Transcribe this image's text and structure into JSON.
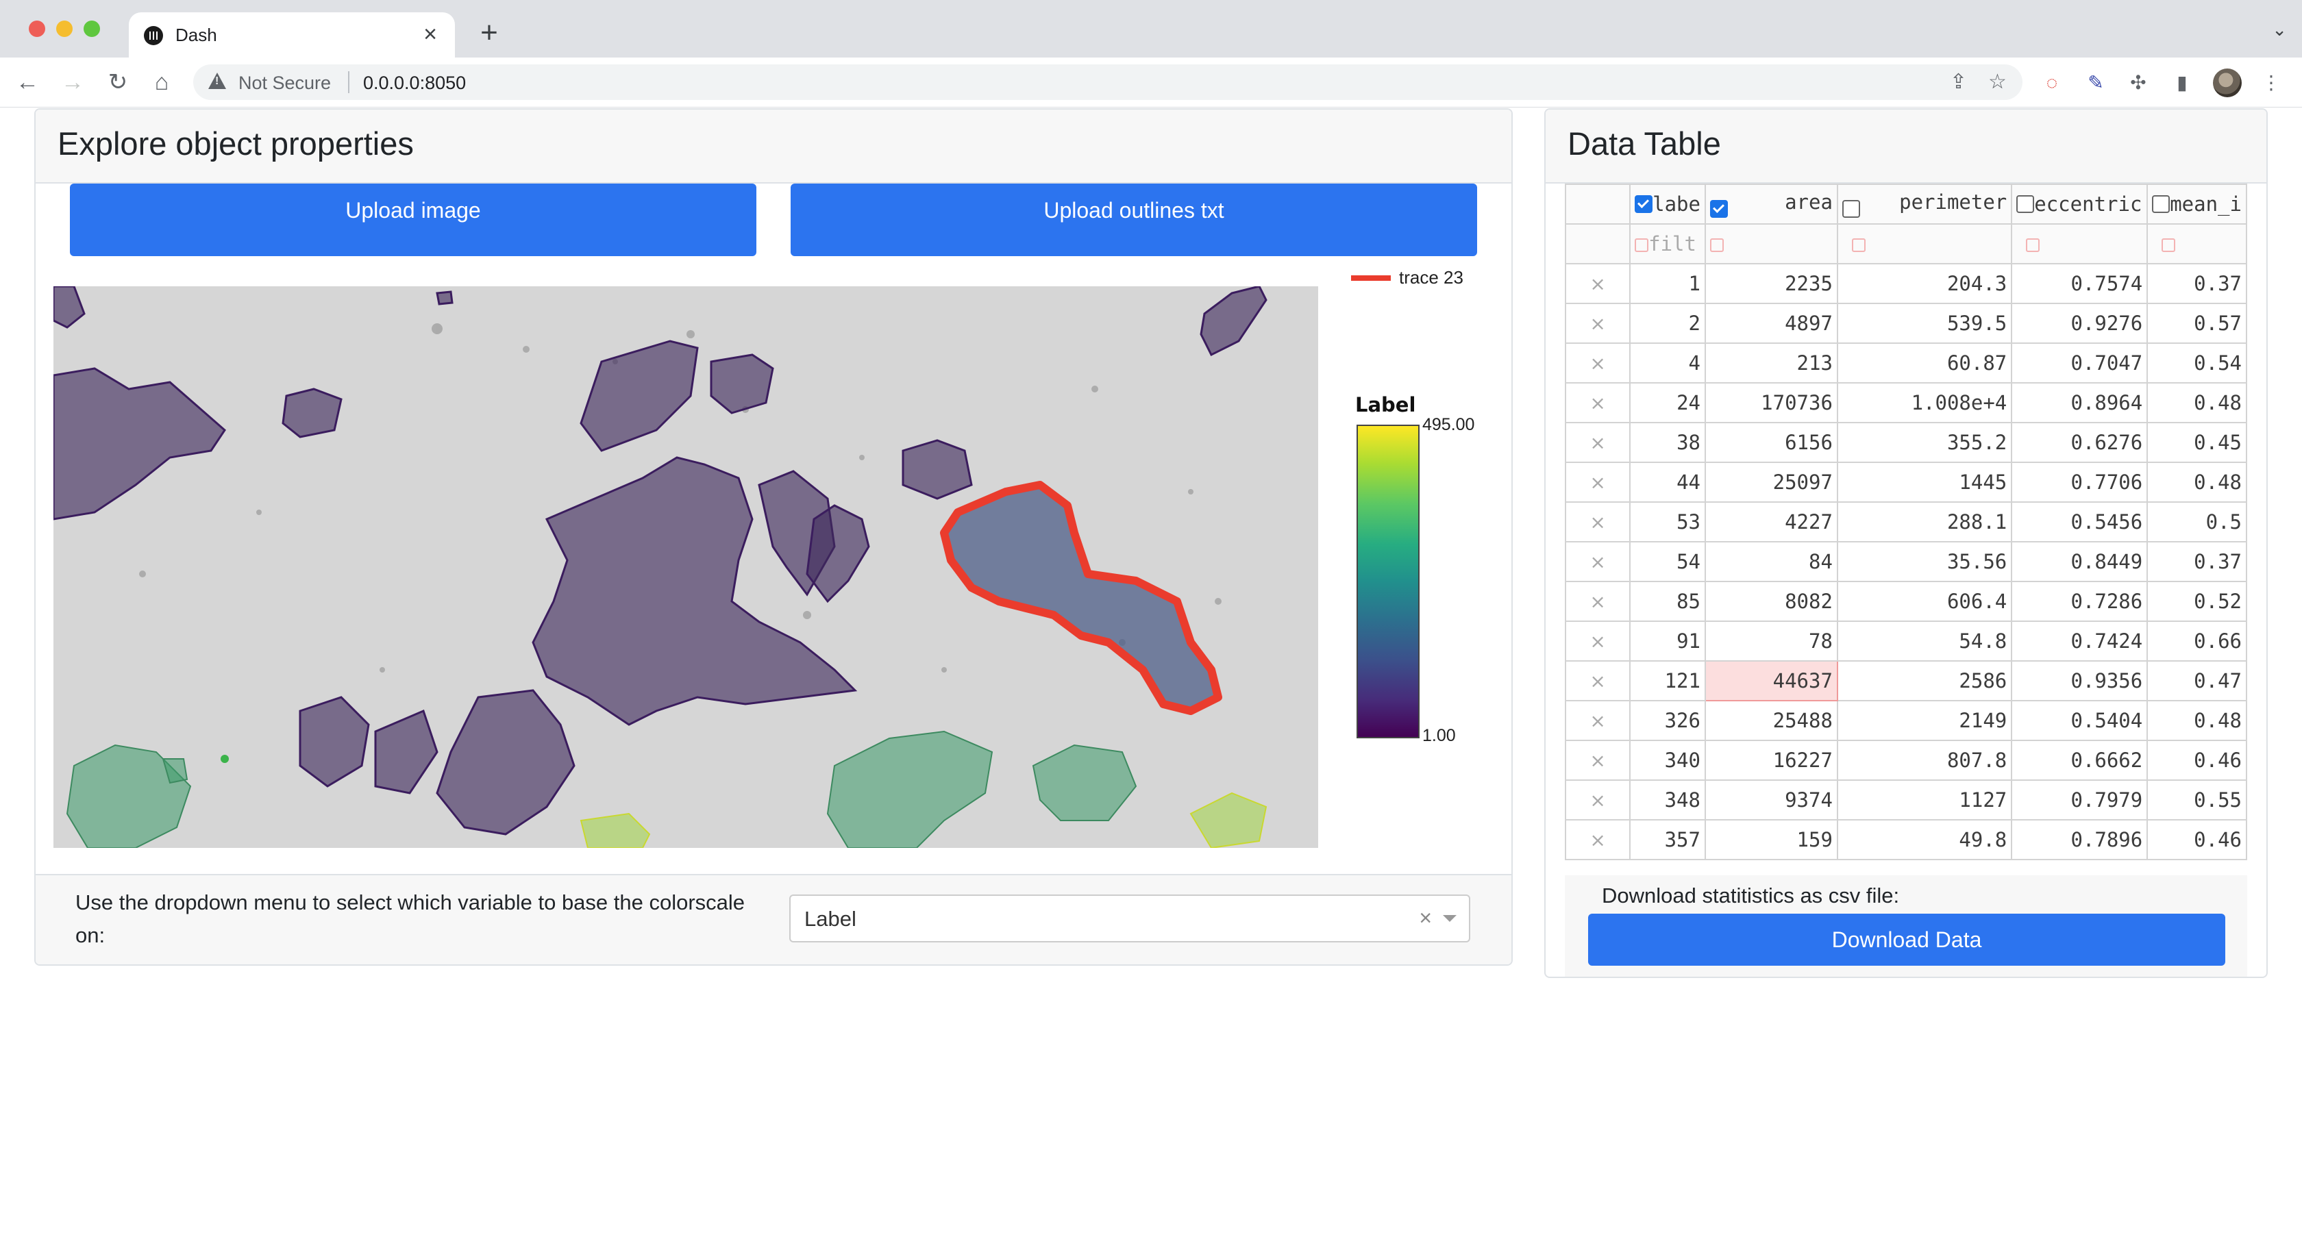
{
  "browser": {
    "tab_title": "Dash",
    "security_label": "Not Secure",
    "url": "0.0.0.0:8050"
  },
  "left_card": {
    "title": "Explore object properties",
    "upload_image_label": "Upload image",
    "upload_outlines_label": "Upload outlines txt",
    "legend_trace": "trace 23",
    "colorbar": {
      "title": "Label",
      "max": "495.00",
      "min": "1.00"
    },
    "footer_text": "Use the dropdown menu to select which variable to base the colorscale on:",
    "dropdown_value": "Label"
  },
  "colors": {
    "accent": "#2c74ef",
    "highlight_trace": "#ea3c2d"
  },
  "right_card": {
    "title": "Data Table",
    "columns": [
      "labe",
      "area",
      "perimeter",
      "eccentric",
      "mean_i"
    ],
    "filter_placeholder": "filt",
    "rows": [
      [
        "1",
        "2235",
        "204.3",
        "0.7574",
        "0.37"
      ],
      [
        "2",
        "4897",
        "539.5",
        "0.9276",
        "0.57"
      ],
      [
        "4",
        "213",
        "60.87",
        "0.7047",
        "0.54"
      ],
      [
        "24",
        "170736",
        "1.008e+4",
        "0.8964",
        "0.48"
      ],
      [
        "38",
        "6156",
        "355.2",
        "0.6276",
        "0.45"
      ],
      [
        "44",
        "25097",
        "1445",
        "0.7706",
        "0.48"
      ],
      [
        "53",
        "4227",
        "288.1",
        "0.5456",
        "0.5"
      ],
      [
        "54",
        "84",
        "35.56",
        "0.8449",
        "0.37"
      ],
      [
        "85",
        "8082",
        "606.4",
        "0.7286",
        "0.52"
      ],
      [
        "91",
        "78",
        "54.8",
        "0.7424",
        "0.66"
      ],
      [
        "121",
        "44637",
        "2586",
        "0.9356",
        "0.47"
      ],
      [
        "326",
        "25488",
        "2149",
        "0.5404",
        "0.48"
      ],
      [
        "340",
        "16227",
        "807.8",
        "0.6662",
        "0.46"
      ],
      [
        "348",
        "9374",
        "1127",
        "0.7979",
        "0.55"
      ],
      [
        "357",
        "159",
        "49.8",
        "0.7896",
        "0.46"
      ]
    ],
    "download_label": "Download statitistics as csv file:",
    "download_button": "Download Data"
  }
}
